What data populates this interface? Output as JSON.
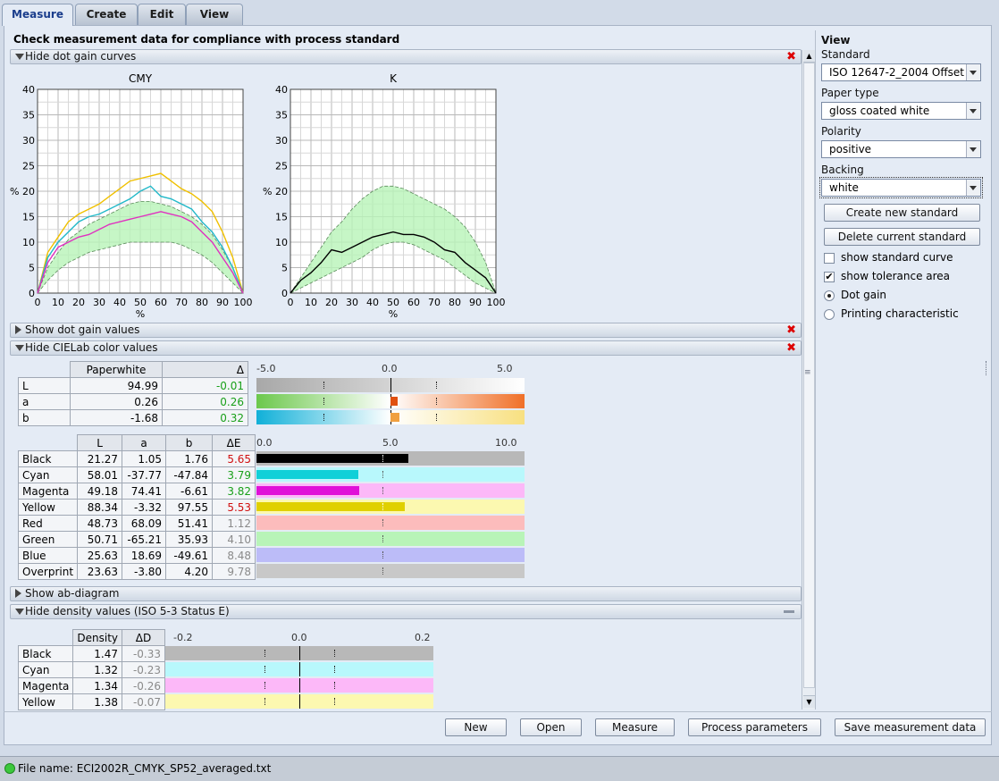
{
  "tabs": [
    {
      "label": "Measure",
      "active": true
    },
    {
      "label": "Create",
      "active": false
    },
    {
      "label": "Edit",
      "active": false
    },
    {
      "label": "View",
      "active": false
    }
  ],
  "heading": "Check measurement data for compliance with process standard",
  "sections": {
    "dotgain_curves": "Hide dot gain curves",
    "dotgain_values": "Show dot gain values",
    "cielab": "Hide CIELab color values",
    "ab_diagram": "Show ab-diagram",
    "density": "Hide density values (ISO 5-3 Status E)"
  },
  "chart_data": [
    {
      "type": "line",
      "title": "CMY",
      "xlabel": "%",
      "ylabel": "%",
      "xlim": [
        0,
        100
      ],
      "ylim": [
        0,
        40
      ],
      "grid": true,
      "x": [
        0,
        5,
        10,
        15,
        20,
        25,
        30,
        35,
        40,
        45,
        50,
        55,
        60,
        65,
        70,
        75,
        80,
        85,
        90,
        95,
        100
      ],
      "tolerance_upper": [
        0,
        5,
        8,
        10.5,
        12,
        13.5,
        14.5,
        15.5,
        16.5,
        17.5,
        18,
        18,
        17.5,
        17,
        16,
        15,
        13.5,
        11.5,
        8.5,
        5,
        0
      ],
      "tolerance_lower": [
        0,
        2.5,
        4.5,
        6,
        7,
        8,
        8.5,
        9,
        9.5,
        10,
        10,
        10,
        10,
        10,
        9.5,
        8.5,
        7.5,
        6,
        4,
        2,
        0
      ],
      "series": [
        {
          "color": "#f0c000",
          "values": [
            0,
            8,
            11,
            14,
            15.5,
            16.5,
            17.5,
            19,
            20.5,
            22,
            22.5,
            23,
            23.5,
            22,
            20.5,
            19.5,
            18,
            16,
            12,
            7,
            0
          ]
        },
        {
          "color": "#20b8c8",
          "values": [
            0,
            7,
            10,
            12,
            14,
            15,
            15.5,
            16.5,
            17.5,
            18.5,
            20,
            21,
            19,
            18.5,
            17.5,
            16.5,
            14,
            12,
            9,
            5,
            0
          ]
        },
        {
          "color": "#e030c0",
          "values": [
            0,
            6,
            9,
            10,
            11,
            11.5,
            12.5,
            13.5,
            14,
            14.5,
            15,
            15.5,
            16,
            15.5,
            15,
            14,
            12,
            10,
            7,
            4,
            0
          ]
        }
      ]
    },
    {
      "type": "line",
      "title": "K",
      "xlabel": "%",
      "ylabel": "%",
      "xlim": [
        0,
        100
      ],
      "ylim": [
        0,
        40
      ],
      "grid": true,
      "x": [
        0,
        5,
        10,
        15,
        20,
        25,
        30,
        35,
        40,
        45,
        50,
        55,
        60,
        65,
        70,
        75,
        80,
        85,
        90,
        95,
        100
      ],
      "tolerance_upper": [
        0,
        3,
        6,
        9,
        12,
        14,
        16.5,
        18.5,
        20,
        21,
        21,
        20.5,
        19.5,
        18.5,
        17.5,
        16.5,
        15,
        13,
        10,
        6,
        0
      ],
      "tolerance_lower": [
        0,
        1,
        2,
        3,
        4,
        5,
        6,
        7,
        8.5,
        9.5,
        10,
        10,
        9.5,
        8.5,
        7.5,
        6.5,
        5,
        3.5,
        2,
        1,
        0
      ],
      "series": [
        {
          "color": "#000000",
          "values": [
            0,
            2.5,
            4,
            6,
            8.5,
            8,
            9,
            10,
            11,
            11.5,
            12,
            11.5,
            11.5,
            11,
            10,
            8.5,
            8,
            6,
            4.5,
            3,
            0
          ]
        }
      ]
    }
  ],
  "chart_ticks": {
    "x": [
      "0",
      "10",
      "20",
      "30",
      "40",
      "50",
      "60",
      "70",
      "80",
      "90",
      "100"
    ],
    "y": [
      "0",
      "5",
      "10",
      "15",
      "20",
      "25",
      "30",
      "35",
      "40"
    ],
    "y_mid_label": "% 20"
  },
  "paperwhite": {
    "headers": [
      "Paperwhite",
      "Δ"
    ],
    "rows": [
      {
        "label": "L",
        "value": "94.99",
        "delta": "-0.01",
        "dcolor": "g"
      },
      {
        "label": "a",
        "value": "0.26",
        "delta": "0.26",
        "dcolor": "g"
      },
      {
        "label": "b",
        "value": "-1.68",
        "delta": "0.32",
        "dcolor": "g"
      }
    ],
    "scale": [
      "-5.0",
      "0.0",
      "5.0"
    ]
  },
  "colors": {
    "headers": [
      "L",
      "a",
      "b",
      "ΔE"
    ],
    "rows": [
      {
        "name": "Black",
        "L": "21.27",
        "a": "1.05",
        "b": "1.76",
        "dE": "5.65",
        "dcolor": "r",
        "fill": 0.565,
        "bar": "#000000",
        "bg": "#b8b8b8"
      },
      {
        "name": "Cyan",
        "L": "58.01",
        "a": "-37.77",
        "b": "-47.84",
        "dE": "3.79",
        "dcolor": "g",
        "fill": 0.379,
        "bar": "#10d0d8",
        "bg": "#b8f8fc"
      },
      {
        "name": "Magenta",
        "L": "49.18",
        "a": "74.41",
        "b": "-6.61",
        "dE": "3.82",
        "dcolor": "g",
        "fill": 0.382,
        "bar": "#e010d8",
        "bg": "#fcb8f8"
      },
      {
        "name": "Yellow",
        "L": "88.34",
        "a": "-3.32",
        "b": "97.55",
        "dE": "5.53",
        "dcolor": "r",
        "fill": 0.553,
        "bar": "#e0d000",
        "bg": "#fcf8b0"
      },
      {
        "name": "Red",
        "L": "48.73",
        "a": "68.09",
        "b": "51.41",
        "dE": "1.12",
        "dcolor": "gr",
        "fill": 0,
        "bar": "#f07070",
        "bg": "#fcbcbc"
      },
      {
        "name": "Green",
        "L": "50.71",
        "a": "-65.21",
        "b": "35.93",
        "dE": "4.10",
        "dcolor": "gr",
        "fill": 0,
        "bar": "#50d050",
        "bg": "#b8f4b8"
      },
      {
        "name": "Blue",
        "L": "25.63",
        "a": "18.69",
        "b": "-49.61",
        "dE": "8.48",
        "dcolor": "gr",
        "fill": 0,
        "bar": "#8080f0",
        "bg": "#bcbcf8"
      },
      {
        "name": "Overprint",
        "L": "23.63",
        "a": "-3.80",
        "b": "4.20",
        "dE": "9.78",
        "dcolor": "gr",
        "fill": 0,
        "bar": "#888888",
        "bg": "#c8c8c8"
      }
    ],
    "scale": [
      "0.0",
      "5.0",
      "10.0"
    ]
  },
  "density": {
    "headers": [
      "Density",
      "ΔD"
    ],
    "rows": [
      {
        "name": "Black",
        "value": "1.47",
        "delta": "-0.33",
        "bg": "#b8b8b8"
      },
      {
        "name": "Cyan",
        "value": "1.32",
        "delta": "-0.23",
        "bg": "#b8f8fc"
      },
      {
        "name": "Magenta",
        "value": "1.34",
        "delta": "-0.26",
        "bg": "#fcb8f8"
      },
      {
        "name": "Yellow",
        "value": "1.38",
        "delta": "-0.07",
        "bg": "#fcf8b0"
      }
    ],
    "scale": [
      "-0.2",
      "0.0",
      "0.2"
    ]
  },
  "right_panel": {
    "title": "View",
    "standard_label": "Standard",
    "standard_value": "ISO 12647-2_2004 Offset",
    "paper_label": "Paper type",
    "paper_value": "gloss coated white",
    "polarity_label": "Polarity",
    "polarity_value": "positive",
    "backing_label": "Backing",
    "backing_value": "white",
    "create_btn": "Create new standard",
    "delete_btn": "Delete current standard",
    "opt_std_curve": "show standard curve",
    "opt_tolerance": "show tolerance area",
    "opt_dotgain": "Dot gain",
    "opt_printing": "Printing characteristic"
  },
  "bottom_buttons": {
    "new": "New",
    "open": "Open",
    "measure": "Measure",
    "process": "Process parameters",
    "save": "Save measurement data"
  },
  "status": "File name: ECI2002R_CMYK_SP52_averaged.txt"
}
